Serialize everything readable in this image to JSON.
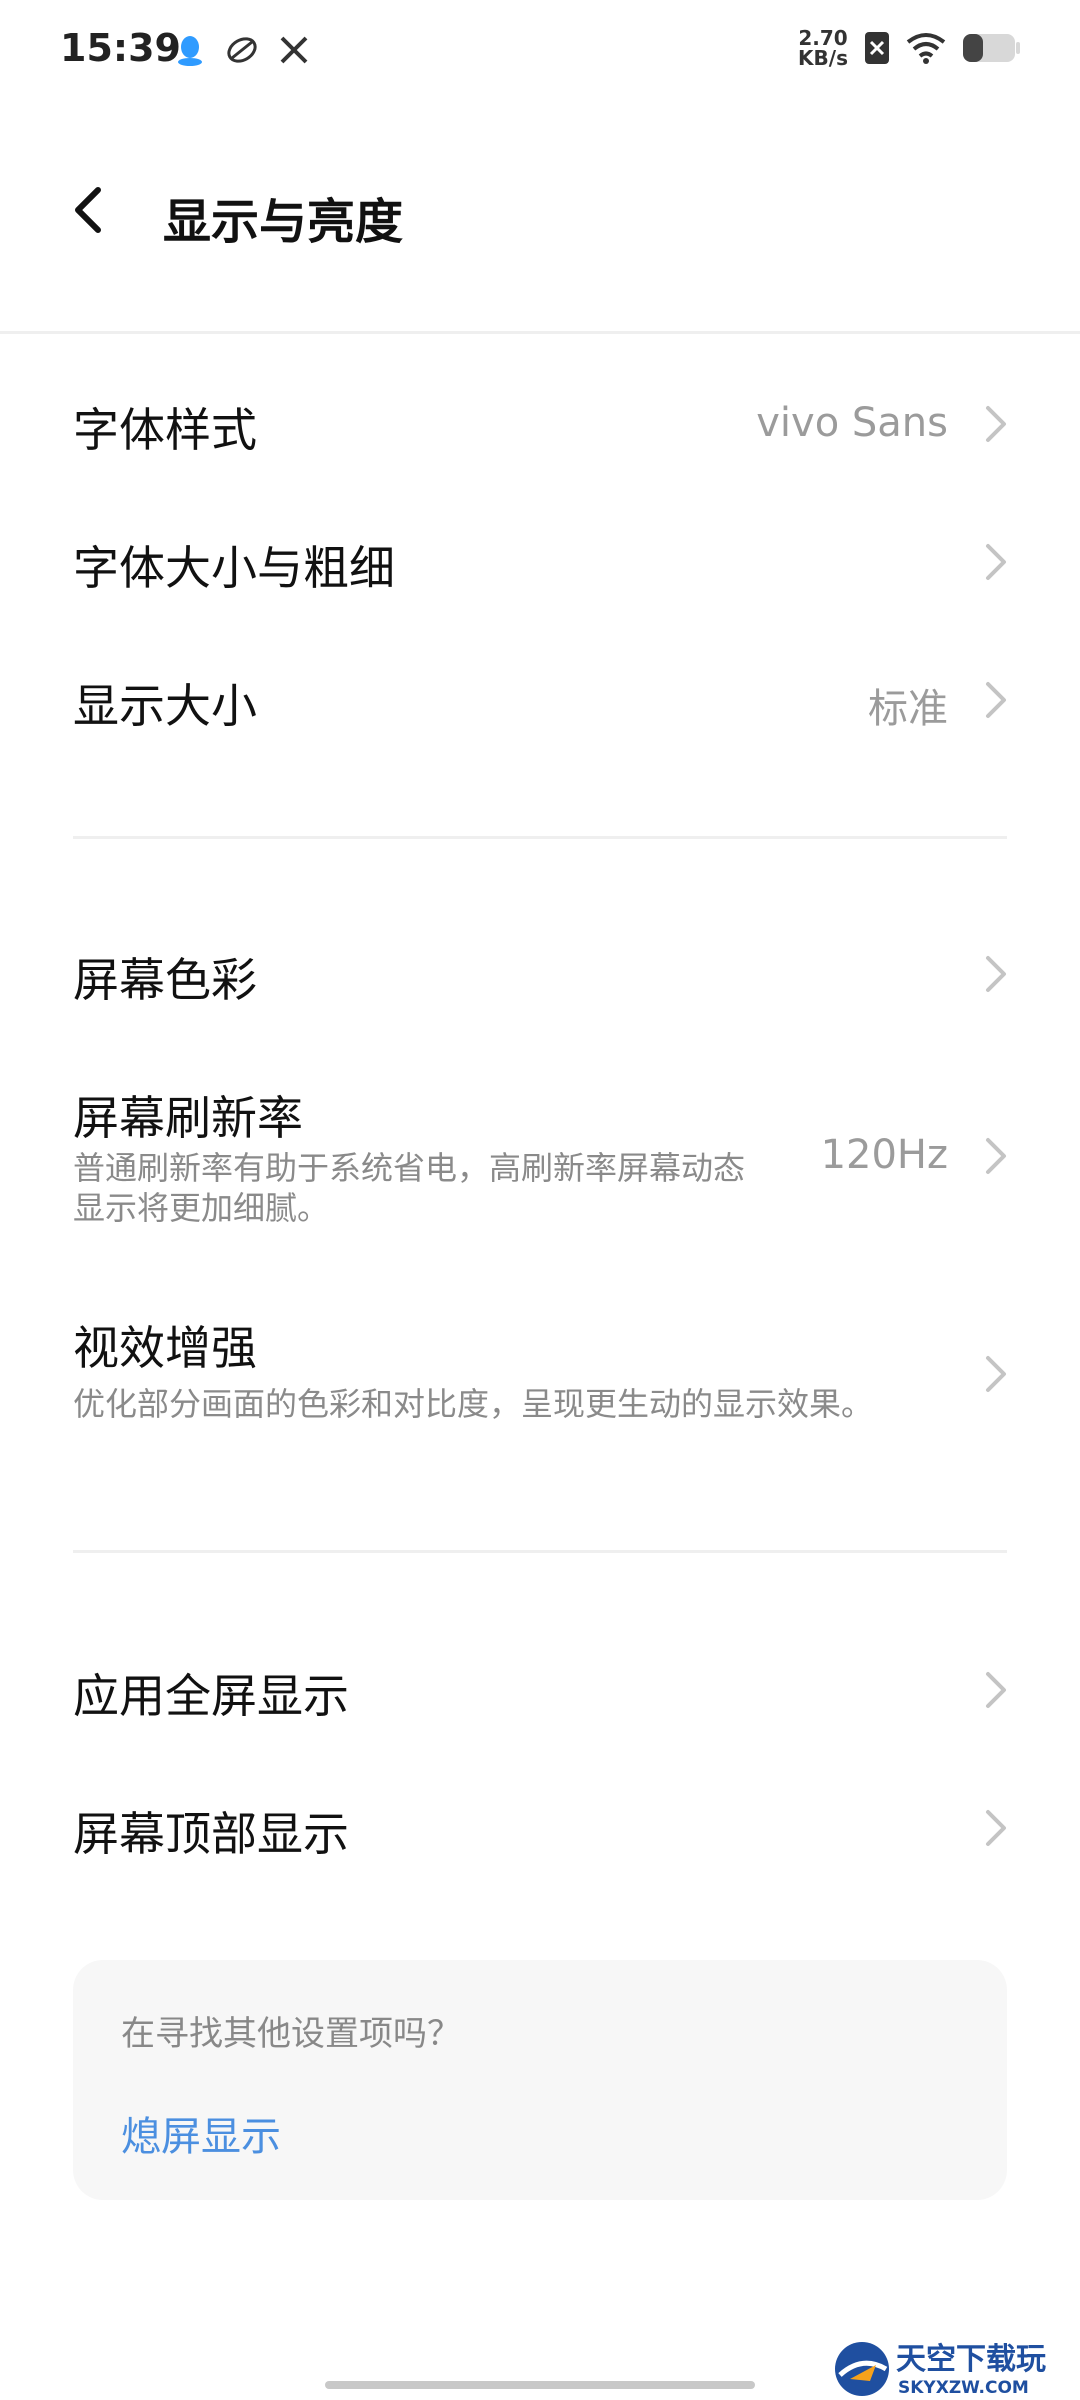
{
  "status_bar": {
    "time": "15:39",
    "net_speed_value": "2.70",
    "net_speed_unit": "KB/s",
    "icons": [
      "qq-icon",
      "sync-icon",
      "tools-icon",
      "sim-off-icon",
      "wifi-icon",
      "battery-icon"
    ]
  },
  "header": {
    "title": "显示与亮度"
  },
  "settings": {
    "font_style": {
      "title": "字体样式",
      "value": "vivo Sans"
    },
    "font_size": {
      "title": "字体大小与粗细"
    },
    "display_size": {
      "title": "显示大小",
      "value": "标准"
    },
    "screen_color": {
      "title": "屏幕色彩"
    },
    "refresh_rate": {
      "title": "屏幕刷新率",
      "subtitle_line1": "普通刷新率有助于系统省电，高刷新率屏幕动态",
      "subtitle_line2": "显示将更加细腻。",
      "value": "120Hz"
    },
    "visual_enhance": {
      "title": "视效增强",
      "subtitle": "优化部分画面的色彩和对比度，呈现更生动的显示效果。"
    },
    "app_fullscreen": {
      "title": "应用全屏显示"
    },
    "screen_top": {
      "title": "屏幕顶部显示"
    }
  },
  "suggestion_card": {
    "question": "在寻找其他设置项吗？",
    "link": "熄屏显示"
  },
  "watermark": {
    "text_top": "天空下载玩",
    "text_bottom": "SKYXZW.COM"
  },
  "colors": {
    "link": "#4b8fe0",
    "secondary_text": "#9b9b9b",
    "divider": "#efefef"
  }
}
